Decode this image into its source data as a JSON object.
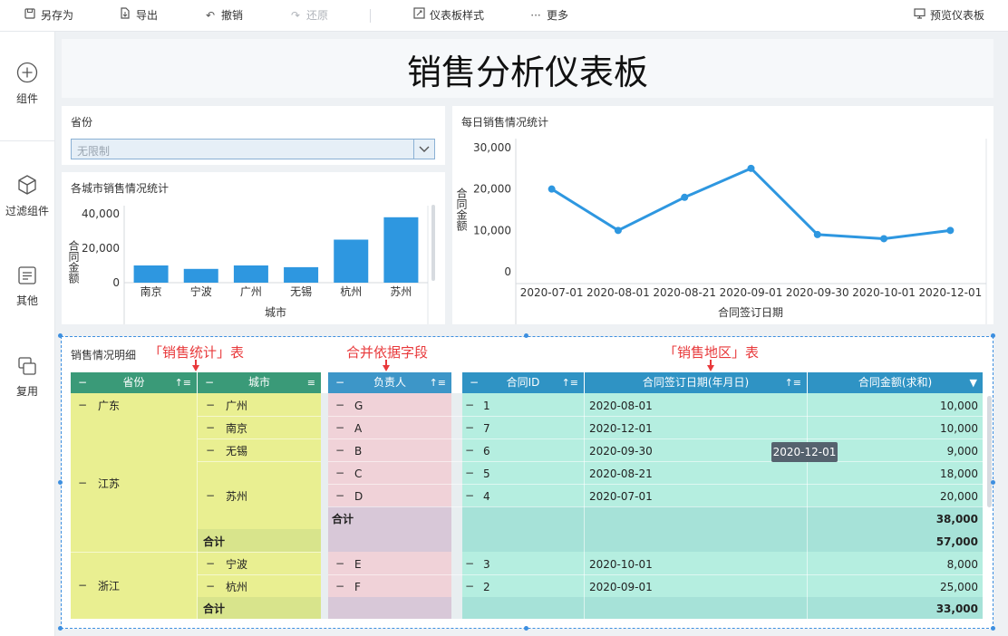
{
  "toolbar": {
    "save_as": "另存为",
    "export": "导出",
    "undo": "撤销",
    "redo": "还原",
    "dashboard_style": "仪表板样式",
    "more": "更多",
    "preview": "预览仪表板"
  },
  "sidebar": {
    "items": [
      {
        "label": "组件",
        "icon": "plus-circle-icon"
      },
      {
        "label": "过滤组件",
        "icon": "cube-icon"
      },
      {
        "label": "其他",
        "icon": "document-icon"
      },
      {
        "label": "复用",
        "icon": "copy-icon"
      }
    ]
  },
  "dashboard": {
    "title": "销售分析仪表板",
    "province_filter": {
      "title": "省份",
      "value": "无限制"
    }
  },
  "annotations": {
    "stats_table": "「销售统计」表",
    "merge_field": "合并依据字段",
    "region_table": "「销售地区」表",
    "color": "#e8393b"
  },
  "detail_table": {
    "title": "销售情况明细",
    "headers": {
      "province": "省份",
      "city": "城市",
      "owner": "负责人",
      "contract_id": "合同ID",
      "sign_date": "合同签订日期(年月日)",
      "amount": "合同金额(求和)"
    },
    "provinces": [
      "广东",
      "江苏",
      "浙江"
    ],
    "cities": [
      "广州",
      "南京",
      "无锡",
      "苏州",
      "宁波",
      "杭州"
    ],
    "rows": [
      {
        "owner": "G",
        "id": "1",
        "date": "2020-08-01",
        "amount": "10,000"
      },
      {
        "owner": "A",
        "id": "7",
        "date": "2020-12-01",
        "amount": "10,000"
      },
      {
        "owner": "B",
        "id": "6",
        "date": "2020-09-30",
        "amount": "9,000"
      },
      {
        "owner": "C",
        "id": "5",
        "date": "2020-08-21",
        "amount": "18,000"
      },
      {
        "owner": "D",
        "id": "4",
        "date": "2020-07-01",
        "amount": "20,000"
      },
      {
        "owner": "E",
        "id": "3",
        "date": "2020-10-01",
        "amount": "8,000"
      },
      {
        "owner": "F",
        "id": "2",
        "date": "2020-09-01",
        "amount": "25,000"
      }
    ],
    "subtotal_label": "合计",
    "subtotals": {
      "suzhou": "38,000",
      "jiangsu": "57,000",
      "zhejiang": "33,000"
    },
    "tooltip": "2020-12-01",
    "colors": {
      "stats_header": "#3a9a78",
      "stats_body": "#e9ef91",
      "stats_subtotal": "#d8e48c",
      "owner_header": "#3d96c8",
      "owner_body": "#f0d2d8",
      "owner_subtotal": "#d8c8d8",
      "region_header": "#2f93c4",
      "region_body": "#b5eee0",
      "region_subtotal": "#a6e2d8"
    }
  },
  "chart_data": [
    {
      "type": "bar",
      "title": "各城市销售情况统计",
      "categories": [
        "南京",
        "宁波",
        "广州",
        "无锡",
        "杭州",
        "苏州"
      ],
      "values": [
        10000,
        8000,
        10000,
        9000,
        25000,
        38000
      ],
      "xlabel": "城市",
      "ylabel": "合同金额",
      "yticks": [
        "0",
        "20,000",
        "40,000"
      ],
      "ylim": [
        0,
        40000
      ],
      "grid": false,
      "color": "#2e97e0"
    },
    {
      "type": "line",
      "title": "每日销售情况统计",
      "x": [
        "2020-07-01",
        "2020-08-01",
        "2020-08-21",
        "2020-09-01",
        "2020-09-30",
        "2020-10-01",
        "2020-12-01"
      ],
      "values": [
        20000,
        10000,
        18000,
        25000,
        9000,
        8000,
        10000
      ],
      "xlabel": "合同签订日期",
      "ylabel": "合同金额",
      "yticks": [
        "0",
        "10,000",
        "20,000",
        "30,000"
      ],
      "ylim": [
        0,
        30000
      ],
      "grid": false,
      "color": "#2e97e0"
    }
  ]
}
